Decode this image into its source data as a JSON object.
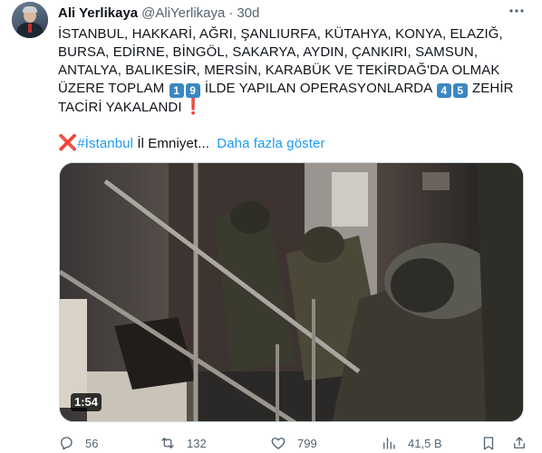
{
  "author": {
    "name": "Ali Yerlikaya",
    "handle": "@AliYerlikaya",
    "separator": "·",
    "time": "30d"
  },
  "tweet": {
    "lines": [
      "İSTANBUL, HAKKARİ, AĞRI, ŞANLIURFA, KÜTAHYA, KONYA, ELAZIĞ,",
      "BURSA, EDİRNE, BİNGÖL, SAKARYA, AYDIN, ÇANKIRI, SAMSUN,",
      "ANTALYA, BALIKESİR, MERSİN, KARABÜK VE TEKİRDAĞ'DA OLMAK"
    ],
    "line4_prefix": "ÜZERE TOPLAM",
    "count_provinces_digits": [
      "1",
      "9"
    ],
    "line4_middle": "İLDE YAPILAN  OPERASYONLARDA",
    "count_dealers_digits": [
      "4",
      "5"
    ],
    "line4_suffix": "ZEHİR",
    "line5": "TACİRİ YAKALANDI",
    "exclamation": "❗",
    "cross_mark": "❌",
    "hashtag": "#İstanbul",
    "trailing_text": "İl Emniyet...",
    "show_more": "Daha fazla göster"
  },
  "media": {
    "duration": "1:54"
  },
  "actions": {
    "replies": "56",
    "reposts": "132",
    "likes": "799",
    "views": "41,5 B"
  },
  "colors": {
    "accent": "#1d9bf0",
    "secondary_text": "#536471",
    "keycap": "#3b88c3",
    "red_mark": "#dd2e44"
  }
}
